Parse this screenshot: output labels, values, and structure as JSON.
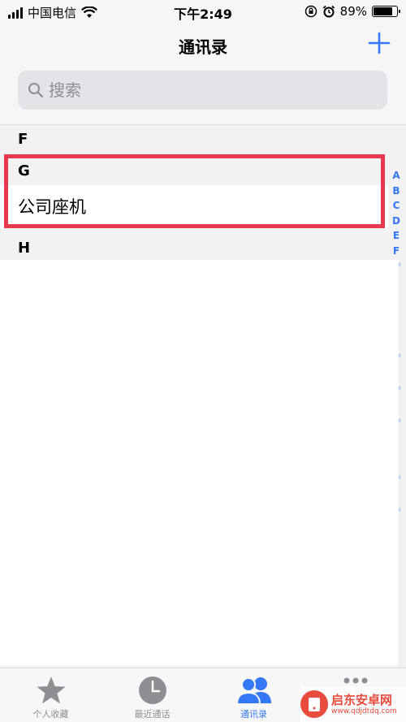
{
  "status_bar": {
    "carrier": "中国电信",
    "time": "下午2:49",
    "battery": "89%",
    "battery_level": 0.89
  },
  "nav": {
    "title": "通讯录",
    "add_icon": "plus-icon"
  },
  "search": {
    "placeholder": "搜索",
    "value": ""
  },
  "sections": [
    {
      "letter": "F",
      "contacts": []
    },
    {
      "letter": "G",
      "contacts": [
        "公司座机"
      ]
    },
    {
      "letter": "H",
      "contacts": []
    }
  ],
  "index": [
    "A",
    "B",
    "C",
    "D",
    "E",
    "F"
  ],
  "highlight_color": "#e8394e",
  "accent_color": "#3478f6",
  "tabs": [
    {
      "label": "个人收藏",
      "icon": "star-icon",
      "active": false
    },
    {
      "label": "最近通话",
      "icon": "clock-icon",
      "active": false
    },
    {
      "label": "通讯录",
      "icon": "contacts-icon",
      "active": true
    },
    {
      "label": "",
      "icon": "keypad-icon",
      "active": false
    }
  ],
  "watermark": {
    "title": "启东安卓网",
    "url": "www.qdjdtdq.com"
  }
}
